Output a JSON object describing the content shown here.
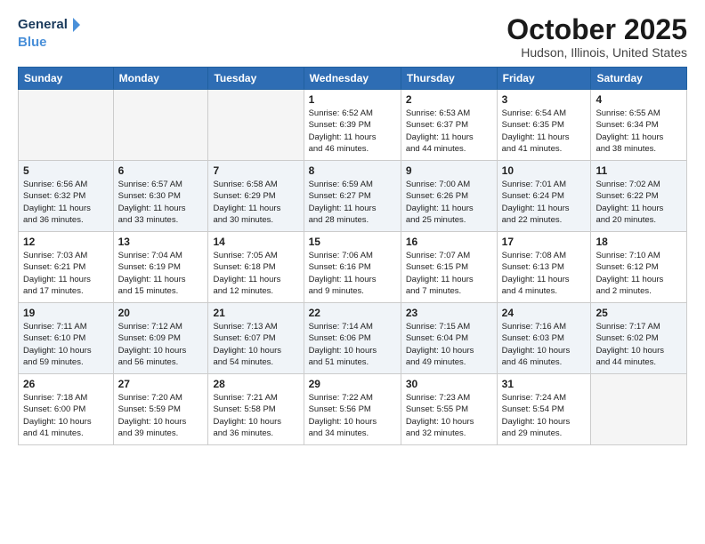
{
  "header": {
    "logo_line1": "General",
    "logo_line2": "Blue",
    "month": "October 2025",
    "location": "Hudson, Illinois, United States"
  },
  "weekdays": [
    "Sunday",
    "Monday",
    "Tuesday",
    "Wednesday",
    "Thursday",
    "Friday",
    "Saturday"
  ],
  "weeks": [
    [
      {
        "day": "",
        "info": ""
      },
      {
        "day": "",
        "info": ""
      },
      {
        "day": "",
        "info": ""
      },
      {
        "day": "1",
        "info": "Sunrise: 6:52 AM\nSunset: 6:39 PM\nDaylight: 11 hours\nand 46 minutes."
      },
      {
        "day": "2",
        "info": "Sunrise: 6:53 AM\nSunset: 6:37 PM\nDaylight: 11 hours\nand 44 minutes."
      },
      {
        "day": "3",
        "info": "Sunrise: 6:54 AM\nSunset: 6:35 PM\nDaylight: 11 hours\nand 41 minutes."
      },
      {
        "day": "4",
        "info": "Sunrise: 6:55 AM\nSunset: 6:34 PM\nDaylight: 11 hours\nand 38 minutes."
      }
    ],
    [
      {
        "day": "5",
        "info": "Sunrise: 6:56 AM\nSunset: 6:32 PM\nDaylight: 11 hours\nand 36 minutes."
      },
      {
        "day": "6",
        "info": "Sunrise: 6:57 AM\nSunset: 6:30 PM\nDaylight: 11 hours\nand 33 minutes."
      },
      {
        "day": "7",
        "info": "Sunrise: 6:58 AM\nSunset: 6:29 PM\nDaylight: 11 hours\nand 30 minutes."
      },
      {
        "day": "8",
        "info": "Sunrise: 6:59 AM\nSunset: 6:27 PM\nDaylight: 11 hours\nand 28 minutes."
      },
      {
        "day": "9",
        "info": "Sunrise: 7:00 AM\nSunset: 6:26 PM\nDaylight: 11 hours\nand 25 minutes."
      },
      {
        "day": "10",
        "info": "Sunrise: 7:01 AM\nSunset: 6:24 PM\nDaylight: 11 hours\nand 22 minutes."
      },
      {
        "day": "11",
        "info": "Sunrise: 7:02 AM\nSunset: 6:22 PM\nDaylight: 11 hours\nand 20 minutes."
      }
    ],
    [
      {
        "day": "12",
        "info": "Sunrise: 7:03 AM\nSunset: 6:21 PM\nDaylight: 11 hours\nand 17 minutes."
      },
      {
        "day": "13",
        "info": "Sunrise: 7:04 AM\nSunset: 6:19 PM\nDaylight: 11 hours\nand 15 minutes."
      },
      {
        "day": "14",
        "info": "Sunrise: 7:05 AM\nSunset: 6:18 PM\nDaylight: 11 hours\nand 12 minutes."
      },
      {
        "day": "15",
        "info": "Sunrise: 7:06 AM\nSunset: 6:16 PM\nDaylight: 11 hours\nand 9 minutes."
      },
      {
        "day": "16",
        "info": "Sunrise: 7:07 AM\nSunset: 6:15 PM\nDaylight: 11 hours\nand 7 minutes."
      },
      {
        "day": "17",
        "info": "Sunrise: 7:08 AM\nSunset: 6:13 PM\nDaylight: 11 hours\nand 4 minutes."
      },
      {
        "day": "18",
        "info": "Sunrise: 7:10 AM\nSunset: 6:12 PM\nDaylight: 11 hours\nand 2 minutes."
      }
    ],
    [
      {
        "day": "19",
        "info": "Sunrise: 7:11 AM\nSunset: 6:10 PM\nDaylight: 10 hours\nand 59 minutes."
      },
      {
        "day": "20",
        "info": "Sunrise: 7:12 AM\nSunset: 6:09 PM\nDaylight: 10 hours\nand 56 minutes."
      },
      {
        "day": "21",
        "info": "Sunrise: 7:13 AM\nSunset: 6:07 PM\nDaylight: 10 hours\nand 54 minutes."
      },
      {
        "day": "22",
        "info": "Sunrise: 7:14 AM\nSunset: 6:06 PM\nDaylight: 10 hours\nand 51 minutes."
      },
      {
        "day": "23",
        "info": "Sunrise: 7:15 AM\nSunset: 6:04 PM\nDaylight: 10 hours\nand 49 minutes."
      },
      {
        "day": "24",
        "info": "Sunrise: 7:16 AM\nSunset: 6:03 PM\nDaylight: 10 hours\nand 46 minutes."
      },
      {
        "day": "25",
        "info": "Sunrise: 7:17 AM\nSunset: 6:02 PM\nDaylight: 10 hours\nand 44 minutes."
      }
    ],
    [
      {
        "day": "26",
        "info": "Sunrise: 7:18 AM\nSunset: 6:00 PM\nDaylight: 10 hours\nand 41 minutes."
      },
      {
        "day": "27",
        "info": "Sunrise: 7:20 AM\nSunset: 5:59 PM\nDaylight: 10 hours\nand 39 minutes."
      },
      {
        "day": "28",
        "info": "Sunrise: 7:21 AM\nSunset: 5:58 PM\nDaylight: 10 hours\nand 36 minutes."
      },
      {
        "day": "29",
        "info": "Sunrise: 7:22 AM\nSunset: 5:56 PM\nDaylight: 10 hours\nand 34 minutes."
      },
      {
        "day": "30",
        "info": "Sunrise: 7:23 AM\nSunset: 5:55 PM\nDaylight: 10 hours\nand 32 minutes."
      },
      {
        "day": "31",
        "info": "Sunrise: 7:24 AM\nSunset: 5:54 PM\nDaylight: 10 hours\nand 29 minutes."
      },
      {
        "day": "",
        "info": ""
      }
    ]
  ]
}
